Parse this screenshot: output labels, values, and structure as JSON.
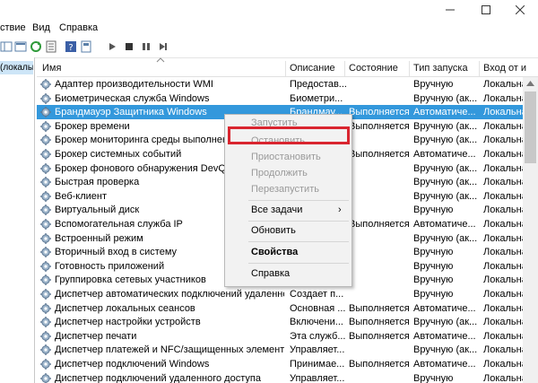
{
  "window": {
    "minimize_icon": "minimize-icon",
    "maximize_icon": "maximize-icon",
    "close_icon": "close-icon"
  },
  "menu": [
    "ствие",
    "Вид",
    "Справка"
  ],
  "left_pane": {
    "item": "(локалы"
  },
  "columns": {
    "name": "Имя",
    "description": "Описание",
    "status": "Состояние",
    "startup": "Тип запуска",
    "logon": "Вход от и"
  },
  "services": [
    {
      "name": "Адаптер производительности WMI",
      "description": "Предостав...",
      "status": "",
      "startup": "Вручную",
      "logon": "Локальна"
    },
    {
      "name": "Биометрическая служба Windows",
      "description": "Биометри...",
      "status": "",
      "startup": "Вручную (ак...",
      "logon": "Локальна"
    },
    {
      "name": "Брандмауэр Защитника Windows",
      "description": "Брандмау...",
      "status": "Выполняется",
      "startup": "Автоматиче...",
      "logon": "Локальна"
    },
    {
      "name": "Брокер времени",
      "description": "",
      "status": "Выполняется",
      "startup": "Вручную (ак...",
      "logon": "Локальна"
    },
    {
      "name": "Брокер мониторинга среды выполнения S",
      "description": "",
      "status": "",
      "startup": "Вручную (ак...",
      "logon": "Локальна"
    },
    {
      "name": "Брокер системных событий",
      "description": "",
      "status": "Выполняется",
      "startup": "Автоматиче...",
      "logon": "Локальна"
    },
    {
      "name": "Брокер фонового обнаружения DevQuery",
      "description": "",
      "status": "",
      "startup": "Вручную (ак...",
      "logon": "Локальна"
    },
    {
      "name": "Быстрая проверка",
      "description": "",
      "status": "",
      "startup": "Вручную (ак...",
      "logon": "Локальна"
    },
    {
      "name": "Веб-клиент",
      "description": "",
      "status": "",
      "startup": "Вручную (ак...",
      "logon": "Локальна"
    },
    {
      "name": "Виртуальный диск",
      "description": "",
      "status": "",
      "startup": "Вручную",
      "logon": "Локальна"
    },
    {
      "name": "Вспомогательная служба IP",
      "description": "",
      "status": "Выполняется",
      "startup": "Автоматиче...",
      "logon": "Локальна"
    },
    {
      "name": "Встроенный режим",
      "description": "",
      "status": "",
      "startup": "Вручную (ак...",
      "logon": "Локальна"
    },
    {
      "name": "Вторичный вход в систему",
      "description": "",
      "status": "",
      "startup": "Вручную",
      "logon": "Локальна"
    },
    {
      "name": "Готовность приложений",
      "description": "",
      "status": "",
      "startup": "Вручную",
      "logon": "Локальна"
    },
    {
      "name": "Группировка сетевых участников",
      "description": "",
      "status": "",
      "startup": "Вручную",
      "logon": "Локальна"
    },
    {
      "name": "Диспетчер автоматических подключений удаленного д...",
      "description": "Создает п...",
      "status": "",
      "startup": "Вручную",
      "logon": "Локальна"
    },
    {
      "name": "Диспетчер локальных сеансов",
      "description": "Основная ...",
      "status": "Выполняется",
      "startup": "Автоматиче...",
      "logon": "Локальна"
    },
    {
      "name": "Диспетчер настройки устройств",
      "description": "Включени...",
      "status": "Выполняется",
      "startup": "Вручную (ак...",
      "logon": "Локальна"
    },
    {
      "name": "Диспетчер печати",
      "description": "Эта служб...",
      "status": "Выполняется",
      "startup": "Автоматиче...",
      "logon": "Локальна"
    },
    {
      "name": "Диспетчер платежей и NFC/защищенных элементов",
      "description": "Управляет...",
      "status": "",
      "startup": "Вручную (ак...",
      "logon": "Локальна"
    },
    {
      "name": "Диспетчер подключений Windows",
      "description": "Принимае...",
      "status": "Выполняется",
      "startup": "Автоматиче...",
      "logon": "Локальна"
    },
    {
      "name": "Диспетчер подключений удаленного доступа",
      "description": "Управляет...",
      "status": "",
      "startup": "Вручную",
      "logon": "Локальна"
    }
  ],
  "context_menu": {
    "start": "Запустить",
    "stop": "Остановить",
    "pause": "Приостановить",
    "resume": "Продолжить",
    "restart": "Перезапустить",
    "all_tasks": "Все задачи",
    "all_tasks_arrow": "›",
    "refresh": "Обновить",
    "properties": "Свойства",
    "help": "Справка"
  },
  "colors": {
    "selection": "#3398dc",
    "highlight_box": "#d9252f",
    "menu_bg": "#f2f2f2"
  }
}
